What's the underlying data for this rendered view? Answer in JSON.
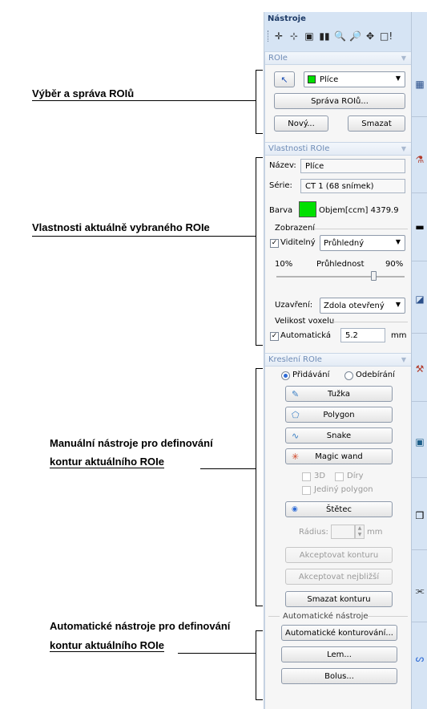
{
  "annotations": {
    "roi_select": "Výběr a správa ROIů",
    "roi_props": "Vlastnosti aktuálně vybraného ROIe",
    "manual_line1": "Manuální nástroje pro definování",
    "manual_line2": "kontur aktuálního ROIe",
    "auto_line1": "Automatické nástroje pro definování",
    "auto_line2": "kontur aktuálního ROIe"
  },
  "panel": {
    "title": "Nástroje",
    "close": "×",
    "toolbar_icons": [
      "✛",
      "⊹",
      "▣",
      "▮▮",
      "🔍",
      "🔎",
      "✥",
      "□!"
    ]
  },
  "rois_section": {
    "header": "ROIe",
    "roi_select_value": "Plíce",
    "roi_color": "#00e000",
    "manage_button": "Správa ROIů...",
    "new_button": "Nový...",
    "delete_button": "Smazat"
  },
  "props_section": {
    "header": "Vlastnosti ROIe",
    "name_label": "Název:",
    "name_value": "Plíce",
    "series_label": "Série:",
    "series_value": "CT 1 (68 snímek)",
    "color_label": "Barva",
    "color_value": "#00e000",
    "volume_text": "Objem[ccm] 4379.9",
    "display_group": "Zobrazení",
    "visible_label": "Viditelný",
    "visible_checked": true,
    "display_mode": "Průhledný",
    "transparency_min": "10%",
    "transparency_label": "Průhlednost",
    "transparency_max": "90%",
    "transparency_level": 0.9,
    "closing_label": "Uzavření:",
    "closing_value": "Zdola otevřený",
    "voxel_group": "Velikost voxelu",
    "auto_label": "Automatická",
    "auto_checked": true,
    "voxel_value": "5.2",
    "voxel_unit": "mm"
  },
  "draw_section": {
    "header": "Kreslení ROIe",
    "add_label": "Přidávání",
    "remove_label": "Odebírání",
    "pencil": "Tužka",
    "polygon": "Polygon",
    "snake": "Snake",
    "magic_wand": "Magic wand",
    "opt_3d": "3D",
    "opt_holes": "Díry",
    "opt_single": "Jediný polygon",
    "brush": "Štětec",
    "radius_label": "Rádius:",
    "radius_unit": "mm",
    "accept_contour": "Akceptovat konturu",
    "accept_nearest": "Akceptovat nejbližší",
    "delete_contour": "Smazat konturu"
  },
  "auto_section": {
    "group": "Automatické nástroje",
    "auto_contour": "Automatické konturování...",
    "margin": "Lem...",
    "bolus": "Bolus..."
  }
}
